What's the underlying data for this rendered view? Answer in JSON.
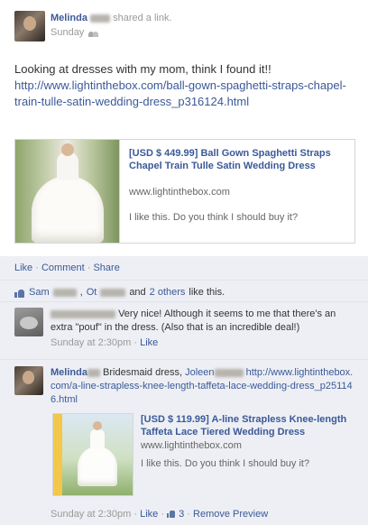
{
  "post": {
    "author": "Melinda",
    "action": "shared a link.",
    "time": "Sunday",
    "privacy_icon": "friends-icon",
    "message": "Looking at dresses with my mom, think I found it!!",
    "url": "http://www.lightinthebox.com/ball-gown-spaghetti-straps-chapel-train-tulle-satin-wedding-dress_p316124.html",
    "preview": {
      "title": "[USD $ 449.99] Ball Gown Spaghetti Straps Chapel Train Tulle Satin Wedding Dress",
      "domain": "www.lightinthebox.com",
      "description": "I like this. Do you think I should buy it?"
    }
  },
  "actions": {
    "like": "Like",
    "comment": "Comment",
    "share": "Share",
    "separator": "·"
  },
  "likes": {
    "name1": "Sam",
    "name2": "Ot",
    "and_text": "and",
    "others": "2 others",
    "suffix": "like this."
  },
  "comments": [
    {
      "text": "Very nice! Although it seems to me that there's an extra \"pouf\" in the dress. (Also that is an incredible deal!)",
      "time": "Sunday at 2:30pm",
      "like_label": "Like"
    },
    {
      "author": "Melinda",
      "text_prefix": "Bridesmaid dress,",
      "mention": "Joleen",
      "url": "http://www.lightinthebox.com/a-line-strapless-knee-length-taffeta-lace-wedding-dress_p251146.html",
      "preview": {
        "title": "[USD $ 119.99] A-line Strapless Knee-length Taffeta Lace Tiered Wedding Dress",
        "domain": "www.lightinthebox.com",
        "description": "I like this. Do you think I should buy it?"
      },
      "time": "Sunday at 2:30pm",
      "like_label": "Like",
      "like_count": "3",
      "remove_preview": "Remove Preview"
    }
  ],
  "colors": {
    "link": "#3b5998",
    "feedback_bg": "#edeff4",
    "text": "#333333",
    "muted": "#999999"
  }
}
